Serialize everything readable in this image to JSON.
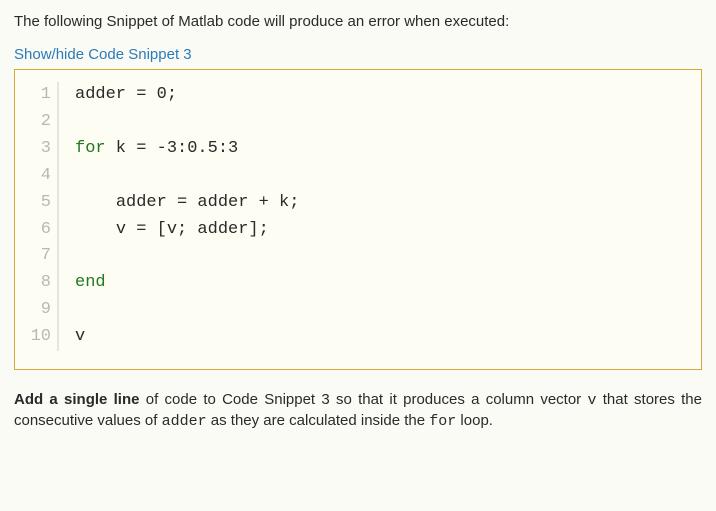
{
  "intro": {
    "prefix": "The following Snippet of Matlab code will produce an error when executed:"
  },
  "toggle": {
    "label": "Show/hide Code Snippet 3"
  },
  "code": {
    "lines": [
      {
        "n": "1",
        "indent": "",
        "segs": [
          {
            "t": "adder = ",
            "c": ""
          },
          {
            "t": "0",
            "c": "num"
          },
          {
            "t": ";",
            "c": ""
          }
        ]
      },
      {
        "n": "2",
        "indent": "",
        "segs": []
      },
      {
        "n": "3",
        "indent": "",
        "segs": [
          {
            "t": "for",
            "c": "kw"
          },
          {
            "t": " k = -",
            "c": ""
          },
          {
            "t": "3",
            "c": "num"
          },
          {
            "t": ":",
            "c": ""
          },
          {
            "t": "0.5",
            "c": "num"
          },
          {
            "t": ":",
            "c": ""
          },
          {
            "t": "3",
            "c": "num"
          }
        ]
      },
      {
        "n": "4",
        "indent": "",
        "segs": []
      },
      {
        "n": "5",
        "indent": "    ",
        "segs": [
          {
            "t": "adder = adder + k;",
            "c": ""
          }
        ]
      },
      {
        "n": "6",
        "indent": "    ",
        "segs": [
          {
            "t": "v = [v; adder];",
            "c": ""
          }
        ]
      },
      {
        "n": "7",
        "indent": "",
        "segs": []
      },
      {
        "n": "8",
        "indent": "",
        "segs": [
          {
            "t": "end",
            "c": "kw"
          }
        ]
      },
      {
        "n": "9",
        "indent": "",
        "segs": []
      },
      {
        "n": "10",
        "indent": "",
        "segs": [
          {
            "t": "v",
            "c": ""
          }
        ]
      }
    ]
  },
  "task": {
    "bold_lead": "Add a single line",
    "part1": " of code to Code Snippet 3 so that it produces a column vector ",
    "code1": "v",
    "part2": " that stores the consecutive values of ",
    "code2": "adder",
    "part3": " as they are calculated inside the ",
    "code3": "for",
    "part4": " loop."
  }
}
